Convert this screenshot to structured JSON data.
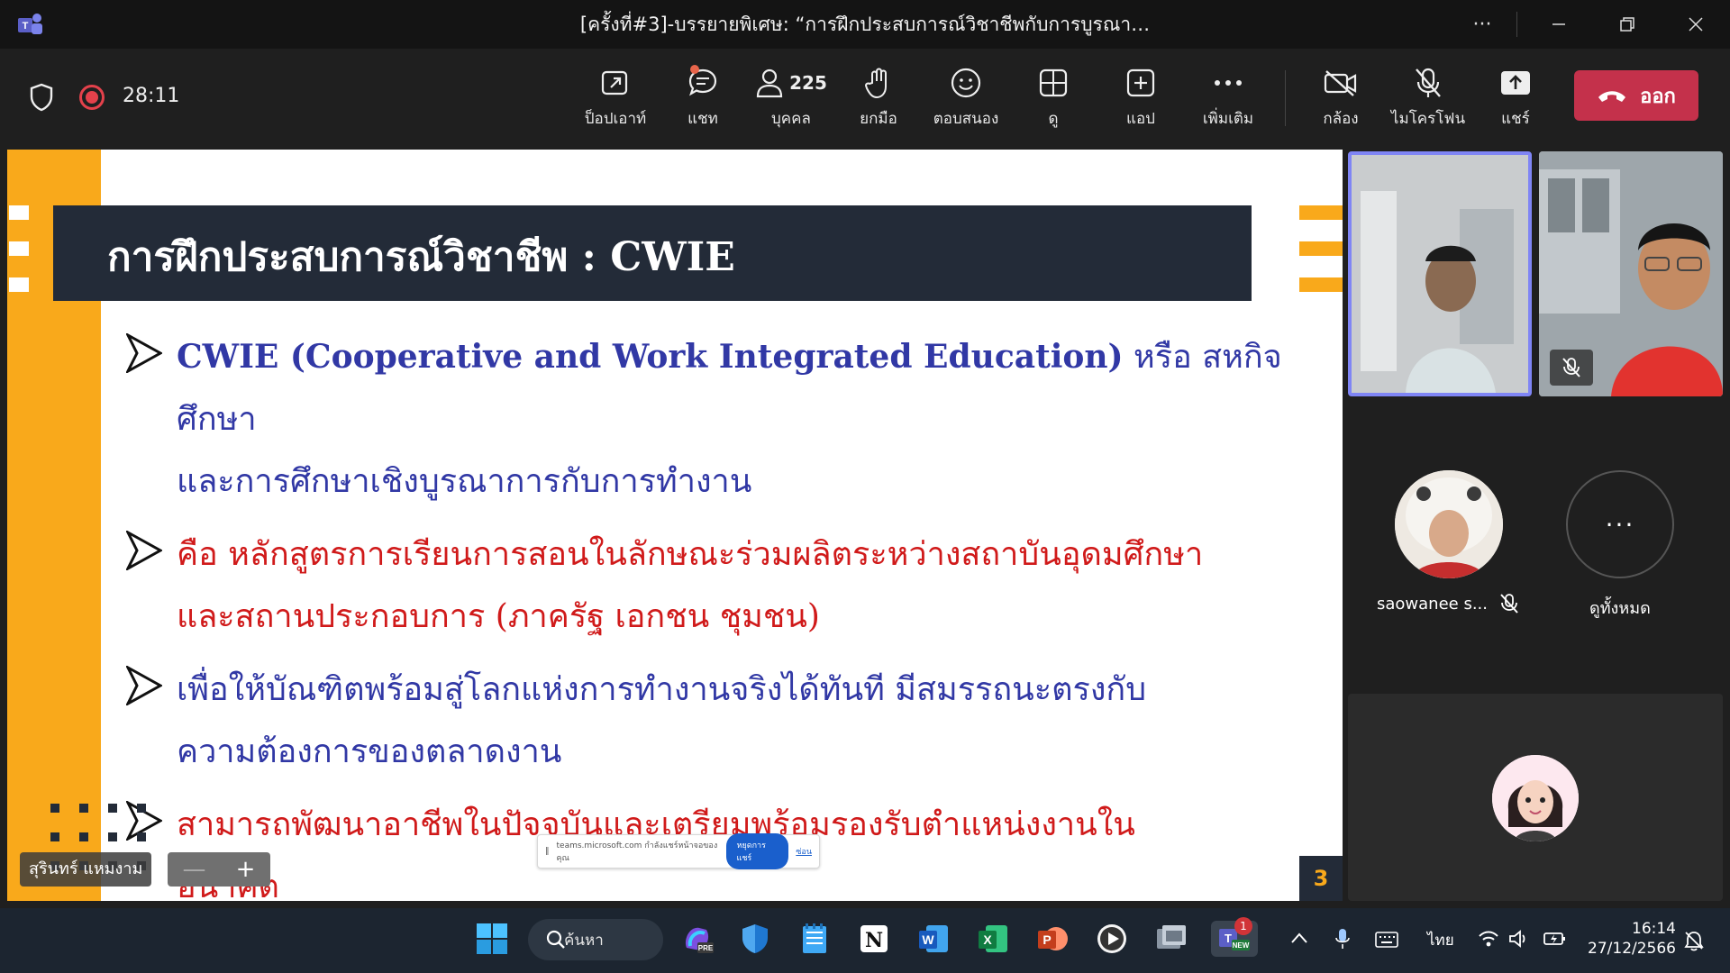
{
  "window": {
    "title": "[ครั้งที่#3]-บรรยายพิเศษ: “การฝึกประสบการณ์วิชาชีพกับการบูรณา…",
    "more_label": "···"
  },
  "meeting": {
    "timer": "28:11",
    "toolbar": [
      {
        "key": "popout",
        "label": "ป็อปเอาท์",
        "icon": "popout-icon"
      },
      {
        "key": "chat",
        "label": "แชท",
        "icon": "chat-icon"
      },
      {
        "key": "people",
        "label": "บุคคล",
        "icon": "people-icon",
        "count": "225"
      },
      {
        "key": "raise",
        "label": "ยกมือ",
        "icon": "raise-hand-icon"
      },
      {
        "key": "react",
        "label": "ตอบสนอง",
        "icon": "react-icon"
      },
      {
        "key": "view",
        "label": "ดู",
        "icon": "view-icon"
      },
      {
        "key": "apps",
        "label": "แอป",
        "icon": "apps-icon"
      },
      {
        "key": "more",
        "label": "เพิ่มเติม",
        "icon": "more-icon"
      },
      {
        "key": "camera",
        "label": "กล้อง",
        "icon": "camera-off-icon"
      },
      {
        "key": "mic",
        "label": "ไมโครโฟน",
        "icon": "mic-off-icon"
      },
      {
        "key": "share",
        "label": "แชร์",
        "icon": "share-icon"
      }
    ],
    "leave_label": "ออก"
  },
  "slide": {
    "title": "การฝึกประสบการณ์วิชาชีพ : CWIE",
    "bullets": [
      {
        "lines": [
          "CWIE (Cooperative and Work Integrated Education) หรือ สหกิจศึกษา",
          "และการศึกษาเชิงบูรณาการกับการทำงาน"
        ],
        "color": "#3138a5"
      },
      {
        "lines": [
          "คือ หลักสูตรการเรียนการสอนในลักษณะร่วมผลิตระหว่างสถาบันอุดมศึกษา",
          "และสถานประกอบการ (ภาครัฐ เอกชน ชุมชน)"
        ],
        "color": "#d01a1a"
      },
      {
        "lines": [
          "เพื่อให้บัณฑิตพร้อมสู่โลกแห่งการทำงานจริงได้ทันที มีสมรรถนะตรงกับ",
          "ความต้องการของตลาดงาน"
        ],
        "color": "#3138a5"
      },
      {
        "lines": [
          "สามารถพัฒนาอาชีพในปัจจุบันและเตรียมพร้อมรองรับตำแหน่งงานใน",
          "อนาคต"
        ],
        "color": "#d01a1a"
      }
    ],
    "bullet1_bold": "CWIE (Cooperative and Work Integrated Education)",
    "bullet1_rest": " หรือ สหกิจศึกษา",
    "page_number": "3",
    "presenter_name": "สุรินทร์ แหมงาม",
    "zoom_out": "—",
    "zoom_in": "+",
    "share_notice": {
      "text": "teams.microsoft.com กำลังแชร์หน้าจอของคุณ",
      "stop_label": "หยุดการแชร์",
      "hide_label": "ซ่อน"
    }
  },
  "participants": {
    "tile_a_name": "saowanee s...",
    "view_all_label": "ดูทั้งหมด",
    "view_all_icon": "···"
  },
  "taskbar": {
    "search_label": "ค้นหา",
    "teams_badge": "1",
    "language": "ไทย",
    "time": "16:14",
    "date": "27/12/2566"
  },
  "colors": {
    "accent": "#f9a91b",
    "header_dark": "#232b38",
    "leave_red": "#c4314b",
    "record_red": "#e4414b",
    "active_border": "#7f85f5"
  }
}
